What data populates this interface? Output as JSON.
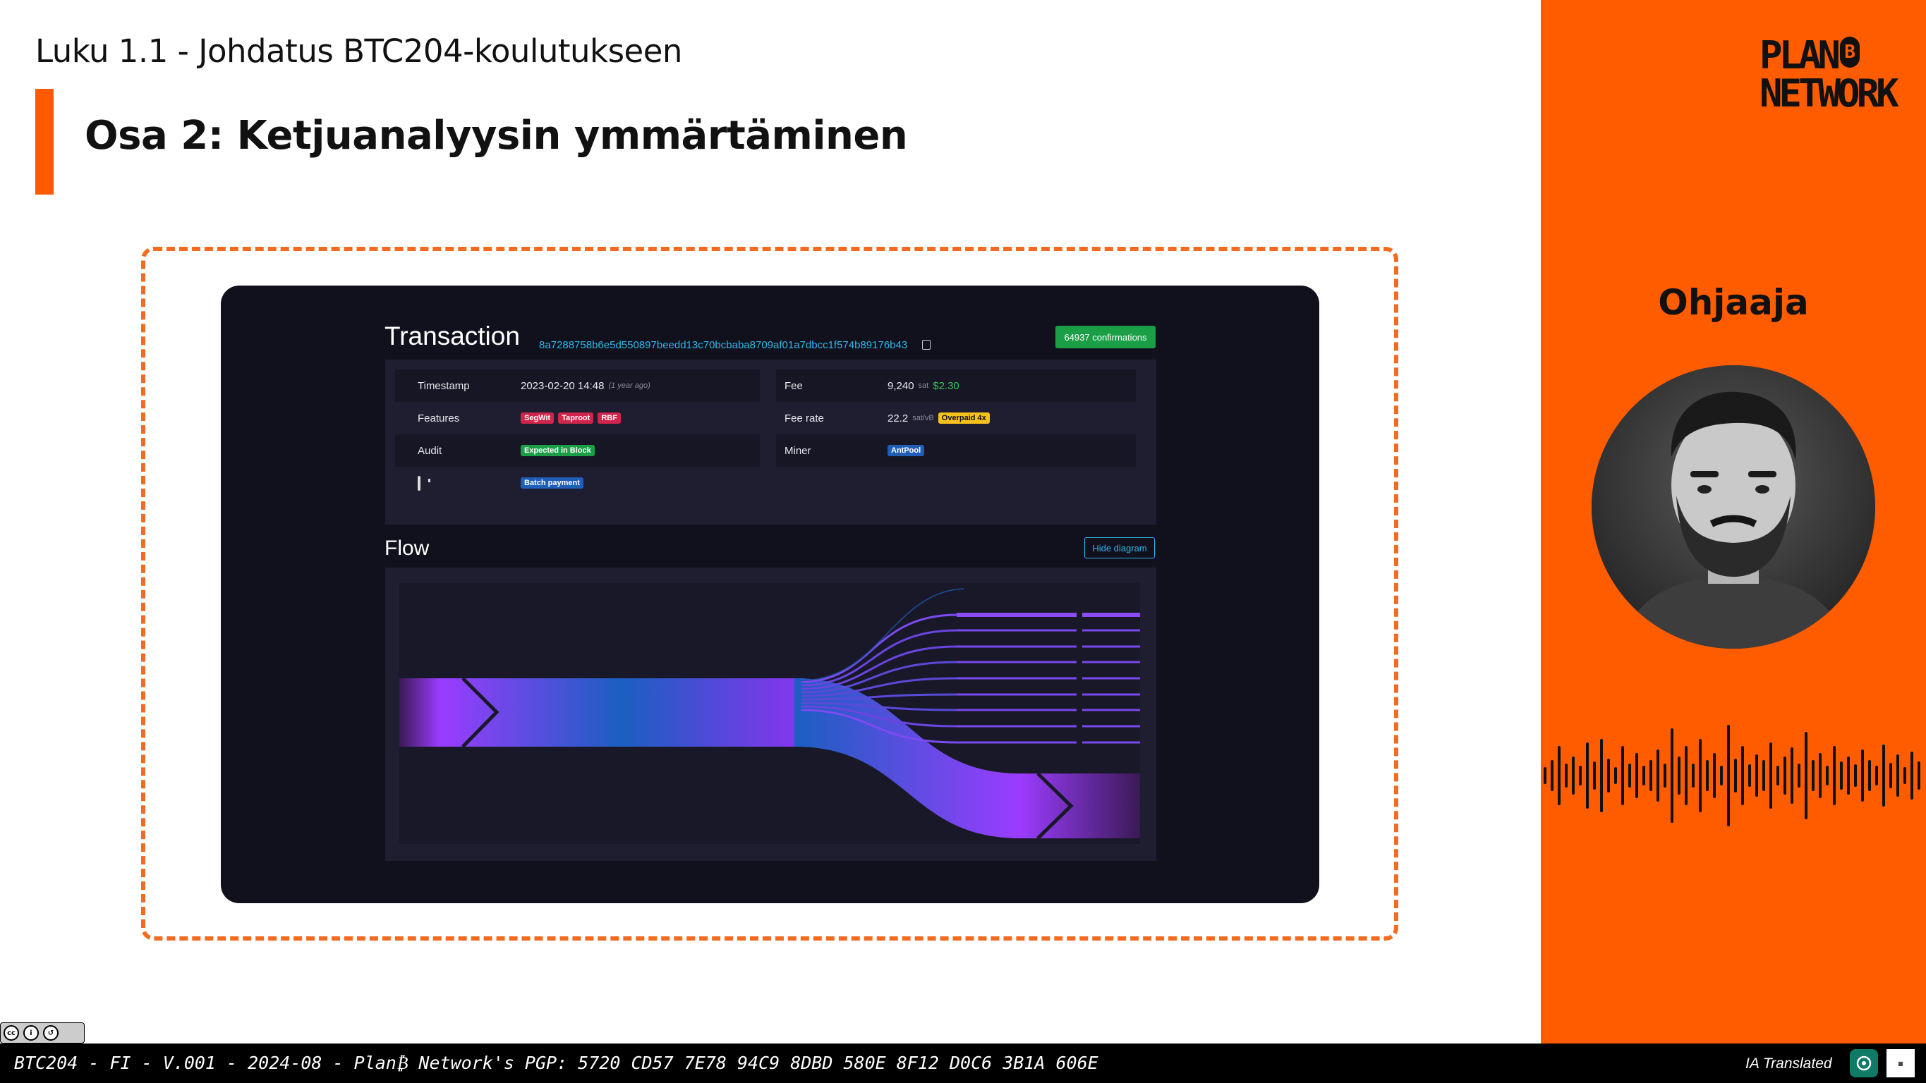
{
  "slide": {
    "chapter_title": "Luku 1.1 - Johdatus BTC204-koulutukseen",
    "section_title": "Osa 2: Ketjuanalyysin ymmärtäminen",
    "accent_color": "#ff5c00"
  },
  "transaction": {
    "title": "Transaction",
    "hash": "8a7288758b6e5d550897beedd13c70bcbaba8709af01a7dbcc1f574b89176b43",
    "confirmations": "64937 confirmations",
    "timestamp_label": "Timestamp",
    "timestamp_value": "2023-02-20 14:48",
    "timestamp_ago": "(1 year ago)",
    "features_label": "Features",
    "features": [
      "SegWit",
      "Taproot",
      "RBF"
    ],
    "audit_label": "Audit",
    "audit_value": "Expected in Block",
    "batch_value": "Batch payment",
    "fee_label": "Fee",
    "fee_value": "9,240",
    "fee_unit": "sat",
    "fee_usd": "$2.30",
    "fee_rate_label": "Fee rate",
    "fee_rate_value": "22.2",
    "fee_rate_unit": "sat/vB",
    "fee_rate_badge": "Overpaid 4x",
    "miner_label": "Miner",
    "miner_value": "AntPool"
  },
  "flow": {
    "title": "Flow",
    "hide_button": "Hide diagram"
  },
  "sidebar": {
    "logo_line1": "PLAN",
    "logo_b": "B",
    "logo_line2": "NETWORK",
    "instructor_label": "Ohjaaja"
  },
  "footer": {
    "text": "BTC204 - FI - V.001 - 2024-08 - Plan₿ Network's PGP: 5720 CD57 7E78 94C9 8DBD 580E 8F12 D0C6 3B1A 606E",
    "translated": "IA Translated",
    "cc_by": "BY",
    "cc_sa": "SA"
  }
}
